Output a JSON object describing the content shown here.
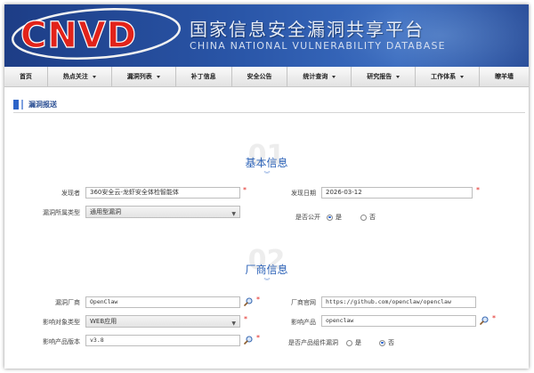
{
  "header": {
    "logo_text": "CNVD",
    "title_cn": "国家信息安全漏洞共享平台",
    "title_en": "CHINA NATIONAL VULNERABILITY DATABASE",
    "colors": {
      "banner": "#2a56a8",
      "logo_red": "#e2231a"
    }
  },
  "nav": {
    "items": [
      {
        "label": "首页",
        "dropdown": false
      },
      {
        "label": "热点关注",
        "dropdown": true
      },
      {
        "label": "漏洞列表",
        "dropdown": true
      },
      {
        "label": "补丁信息",
        "dropdown": false
      },
      {
        "label": "安全公告",
        "dropdown": false
      },
      {
        "label": "统计查询",
        "dropdown": true
      },
      {
        "label": "研究报告",
        "dropdown": true
      },
      {
        "label": "工作体系",
        "dropdown": true
      },
      {
        "label": "瞭羊墙",
        "dropdown": false
      }
    ]
  },
  "breadcrumb": {
    "label": "漏洞报送"
  },
  "section1": {
    "number": "01",
    "title": "基本信息",
    "finder_label": "发现者",
    "finder_value": "360安全云-龙虾安全体检智能体",
    "date_label": "发现日期",
    "date_value": "2026-03-12",
    "type_label": "漏洞所属类型",
    "type_value": "通用型漏洞",
    "public_label": "是否公开",
    "public_yes": "是",
    "public_no": "否",
    "public_selected": "是"
  },
  "section2": {
    "number": "02",
    "title": "厂商信息",
    "vendor_label": "漏洞厂商",
    "vendor_value": "OpenClaw",
    "website_label": "厂商官网",
    "website_value": "https://github.com/openclaw/openclaw",
    "target_type_label": "影响对象类型",
    "target_type_value": "WEB应用",
    "product_label": "影响产品",
    "product_value": "openclaw",
    "version_label": "影响产品版本",
    "version_value": "v3.8",
    "component_label": "是否产品组件漏洞",
    "component_yes": "是",
    "component_no": "否",
    "component_selected": "否"
  },
  "required_mark": "*"
}
